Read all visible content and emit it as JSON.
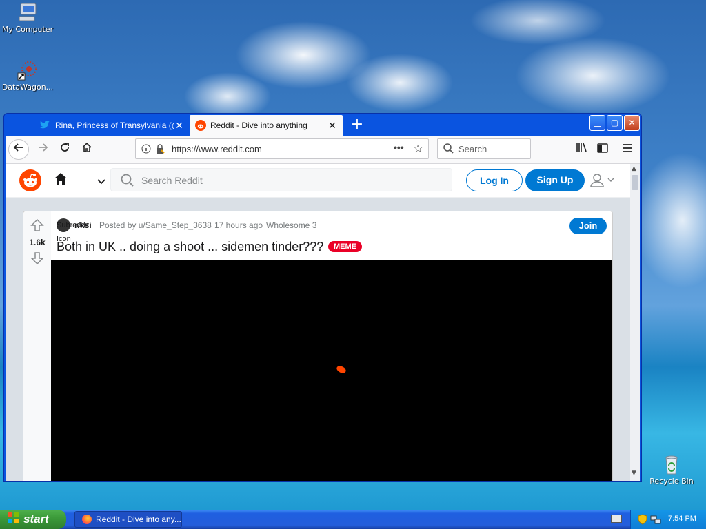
{
  "desktop": {
    "icons": [
      {
        "label": "My Computer"
      },
      {
        "label": "DataWagon..."
      },
      {
        "label": "Recycle Bin"
      }
    ]
  },
  "browser": {
    "tabs": [
      {
        "label": "Rina, Princess of Transylvania (@C",
        "active": false
      },
      {
        "label": "Reddit - Dive into anything",
        "active": true
      }
    ],
    "url": "https://www.reddit.com",
    "search_placeholder": "Search"
  },
  "reddit": {
    "search_placeholder": "Search Reddit",
    "login_label": "Log In",
    "signup_label": "Sign Up",
    "post": {
      "votes": "1.6k",
      "subreddit_overlap": "r/ksi",
      "subreddit_text": "Subreddit",
      "icon_text": "Icon",
      "posted_by": "Posted by u/Same_Step_3638",
      "time": "17 hours ago",
      "award": "Wholesome 3",
      "join_label": "Join",
      "title": "Both in UK .. doing a shoot ... sidemen tinder???",
      "flair": "MEME"
    }
  },
  "taskbar": {
    "start_label": "start",
    "task_label": "Reddit - Dive into any...",
    "clock": "7:54 PM"
  },
  "colors": {
    "reddit_orange": "#ff4500",
    "reddit_blue": "#0079d3",
    "flair_red": "#ea0027",
    "xp_blue": "#0a54e0",
    "start_green": "#3c9b3a"
  }
}
